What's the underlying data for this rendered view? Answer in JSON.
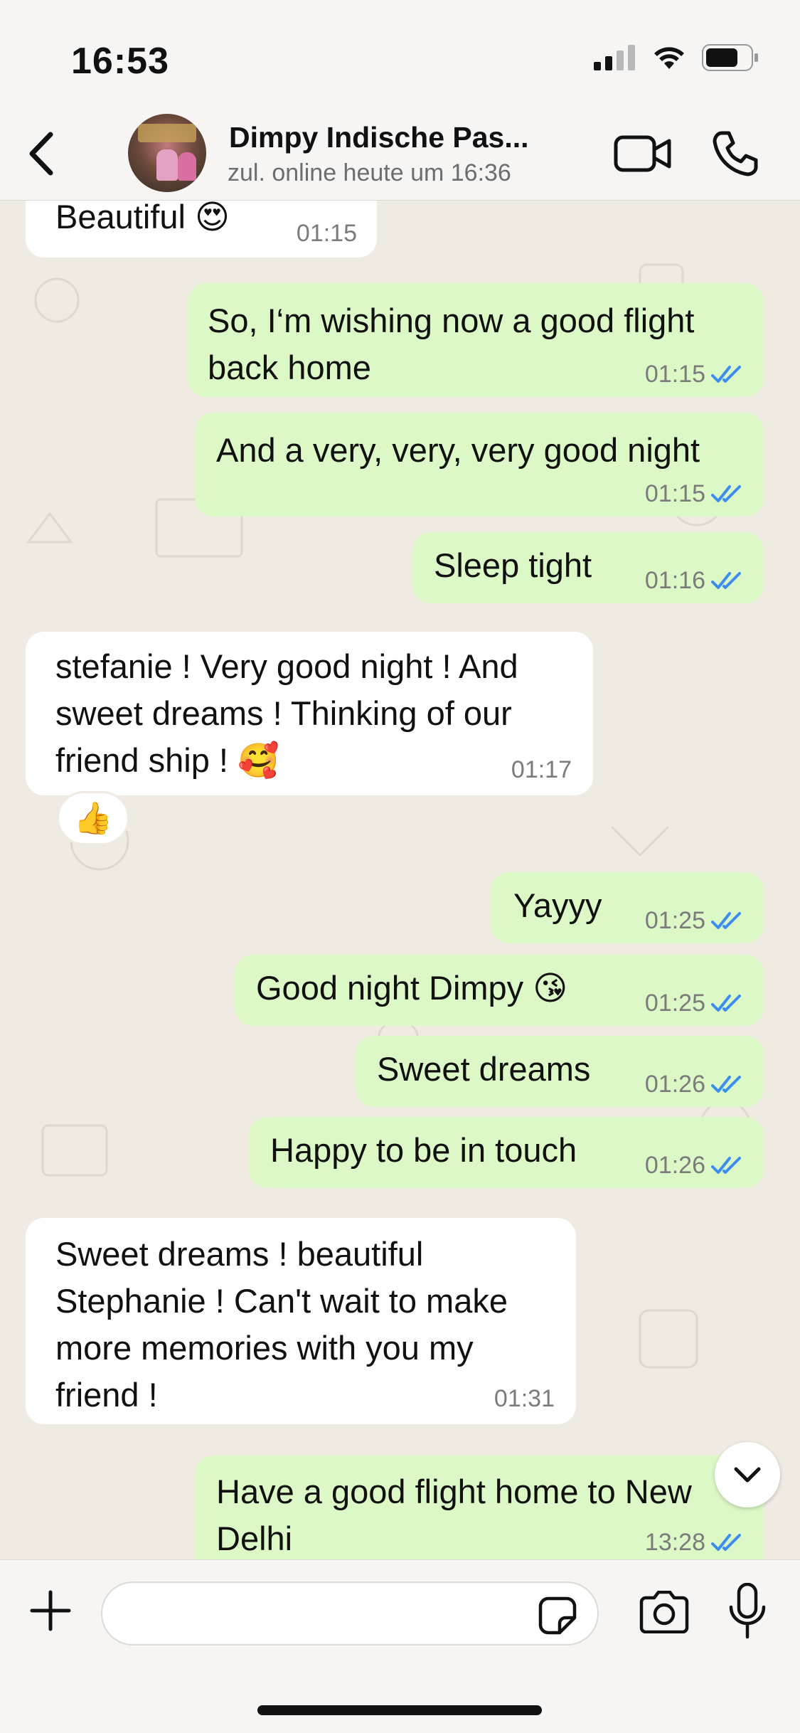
{
  "status_bar": {
    "time": "16:53"
  },
  "header": {
    "contact_name": "Dimpy Indische Pas...",
    "contact_status": "zul. online heute um 16:36"
  },
  "messages": [
    {
      "dir": "in",
      "text": "Beautiful 😍",
      "time": "01:15"
    },
    {
      "dir": "out",
      "text": "So, I‘m wishing now a good flight back home",
      "time": "01:15"
    },
    {
      "dir": "out",
      "text": "And a very, very, very good night",
      "time": "01:15"
    },
    {
      "dir": "out",
      "text": "Sleep tight",
      "time": "01:16"
    },
    {
      "dir": "in",
      "text": "stefanie ! Very good night ! And sweet dreams ! Thinking of our friend ship !  🥰",
      "time": "01:17",
      "reaction": "👍"
    },
    {
      "dir": "out",
      "text": "Yayyy",
      "time": "01:25"
    },
    {
      "dir": "out",
      "text": "Good night Dimpy 😘",
      "time": "01:25"
    },
    {
      "dir": "out",
      "text": "Sweet dreams",
      "time": "01:26"
    },
    {
      "dir": "out",
      "text": "Happy to be in touch",
      "time": "01:26"
    },
    {
      "dir": "in",
      "text": "Sweet dreams ! beautiful Stephanie ! Can't wait to make more memories with you my friend !",
      "time": "01:31"
    },
    {
      "dir": "out",
      "text": "Have a good flight home to New Delhi",
      "time": "13:28"
    }
  ],
  "composer": {
    "placeholder": ""
  },
  "colors": {
    "incoming_bubble": "#ffffff",
    "outgoing_bubble": "#dcf8c6",
    "read_ticks": "#3b8ef0",
    "chat_background": "#efeae2"
  },
  "icons": {
    "back": "chevron-left-icon",
    "video": "video-camera-icon",
    "call": "phone-icon",
    "add": "plus-icon",
    "sticker": "sticker-icon",
    "camera": "camera-icon",
    "mic": "microphone-icon",
    "scroll": "chevron-down-icon"
  }
}
